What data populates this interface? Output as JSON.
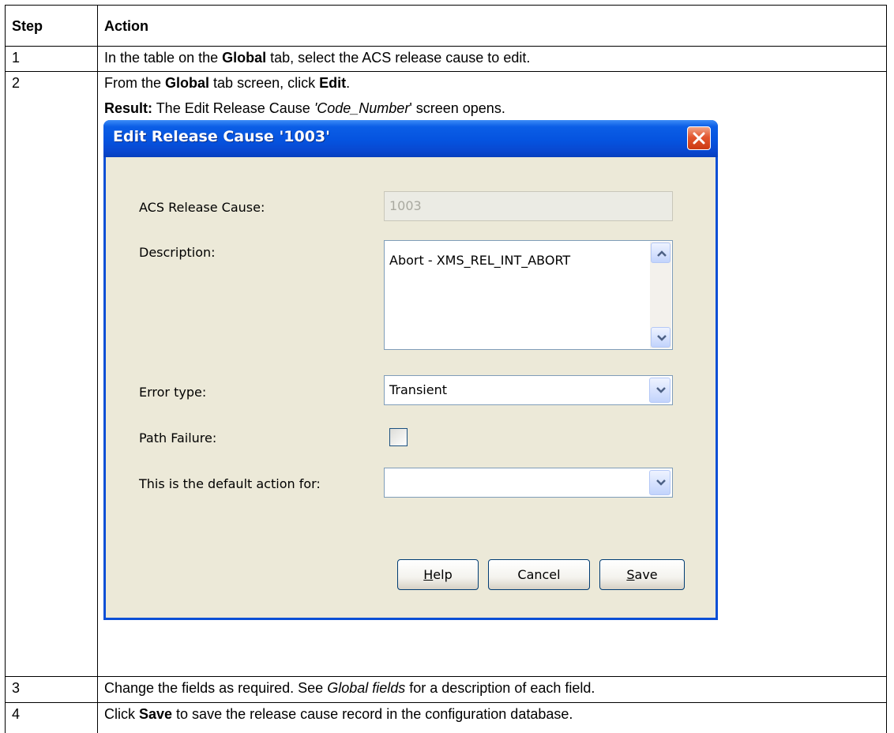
{
  "table": {
    "header": {
      "step": "Step",
      "action": "Action"
    },
    "rows": [
      {
        "step": "1",
        "parts": [
          "In the table on the ",
          "Global",
          " tab, select the ACS release cause to edit."
        ]
      },
      {
        "step": "2",
        "line1": [
          "From the ",
          "Global",
          " tab screen, click ",
          "Edit",
          "."
        ],
        "line2": [
          "Result:",
          " The Edit Release Cause ",
          "'Code_Number",
          "' screen opens."
        ]
      },
      {
        "step": "3",
        "parts": [
          "Change the fields as required. See ",
          "Global fields",
          " for a description of each field."
        ]
      },
      {
        "step": "4",
        "parts": [
          "Click ",
          "Save",
          " to save the release cause record in the configuration database."
        ]
      }
    ]
  },
  "dialog": {
    "title": "Edit Release Cause '1003'",
    "acs_release_cause": {
      "label": "ACS Release Cause:",
      "value": "1003"
    },
    "description": {
      "label": "Description:",
      "value": "Abort - XMS_REL_INT_ABORT"
    },
    "error_type": {
      "label": "Error type:",
      "value": "Transient"
    },
    "path_failure": {
      "label": "Path Failure:",
      "checked": false
    },
    "default_action": {
      "label": "This is the default action for:",
      "value": ""
    },
    "buttons": {
      "help": {
        "accel": "H",
        "rest": "elp"
      },
      "cancel": {
        "label": "Cancel"
      },
      "save": {
        "accel": "S",
        "rest": "ave"
      }
    }
  },
  "colors": {
    "titlebar": "#0553df",
    "dialog_bg": "#ece9d8",
    "close_button": "#e2562f",
    "field_border": "#7f9db9"
  },
  "icons": {
    "close": "close-x-icon",
    "dropdown": "chevron-down-icon",
    "scroll_up": "chevron-up-icon",
    "scroll_down": "chevron-down-icon"
  }
}
